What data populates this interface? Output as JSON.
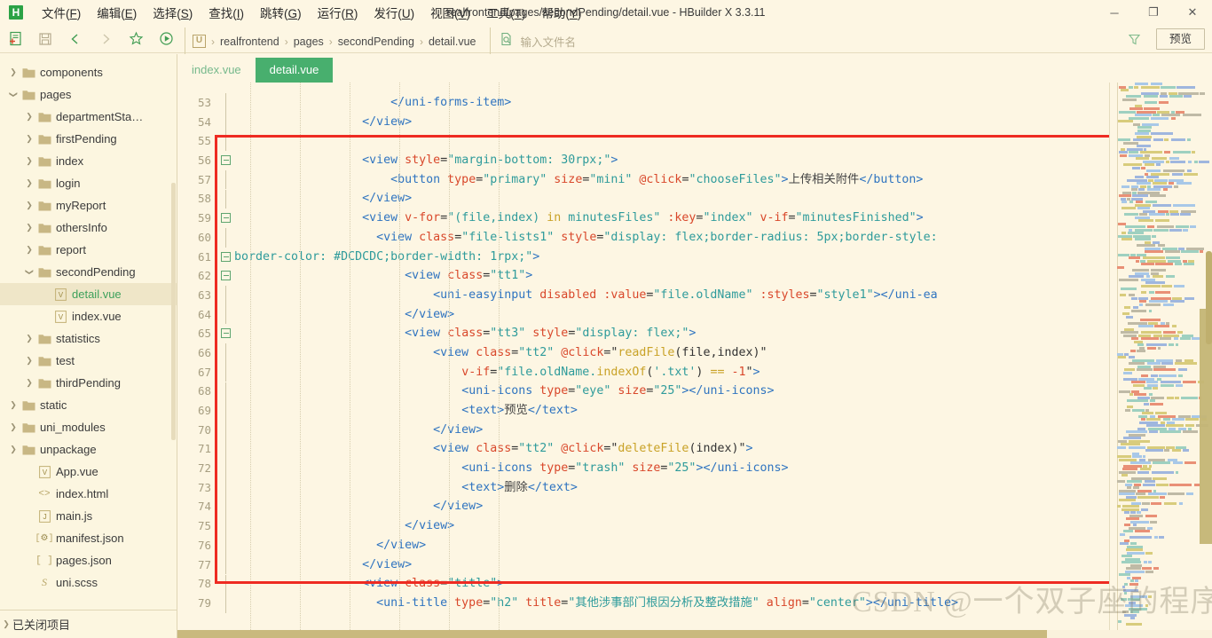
{
  "window": {
    "title": "realfrontend/pages/secondPending/detail.vue - HBuilder X 3.3.11",
    "logo_text": "H",
    "minimize_label": "─",
    "maximize_label": "❐",
    "close_label": "✕"
  },
  "menubar": {
    "items": [
      {
        "label": "文件(F)",
        "name": "menu-file"
      },
      {
        "label": "编辑(E)",
        "name": "menu-edit"
      },
      {
        "label": "选择(S)",
        "name": "menu-select"
      },
      {
        "label": "查找(I)",
        "name": "menu-find"
      },
      {
        "label": "跳转(G)",
        "name": "menu-goto"
      },
      {
        "label": "运行(R)",
        "name": "menu-run"
      },
      {
        "label": "发行(U)",
        "name": "menu-publish"
      },
      {
        "label": "视图(V)",
        "name": "menu-view"
      },
      {
        "label": "工具(T)",
        "name": "menu-tools"
      },
      {
        "label": "帮助(Y)",
        "name": "menu-help"
      }
    ]
  },
  "toolbar": {
    "icons": [
      {
        "name": "new-file-icon",
        "glyph": "new"
      },
      {
        "name": "save-icon",
        "glyph": "save"
      },
      {
        "name": "back-icon",
        "glyph": "‹"
      },
      {
        "name": "forward-icon",
        "glyph": "›"
      },
      {
        "name": "bookmark-icon",
        "glyph": "☆"
      },
      {
        "name": "run-icon",
        "glyph": "▶"
      }
    ],
    "breadcrumb": {
      "badge": "U",
      "items": [
        "realfrontend",
        "pages",
        "secondPending",
        "detail.vue"
      ],
      "separator": "›"
    },
    "search": {
      "placeholder": "输入文件名",
      "icon": "search-file-icon"
    },
    "filter_icon": "filter-icon",
    "preview_label": "预览"
  },
  "sidebar": {
    "closed_projects_label": "已关闭项目",
    "tree": [
      {
        "label": "components",
        "depth": 1,
        "kind": "folder",
        "state": "collapsed"
      },
      {
        "label": "pages",
        "depth": 1,
        "kind": "folder",
        "state": "expanded"
      },
      {
        "label": "departmentSta…",
        "depth": 2,
        "kind": "folder",
        "state": "collapsed"
      },
      {
        "label": "firstPending",
        "depth": 2,
        "kind": "folder",
        "state": "collapsed"
      },
      {
        "label": "index",
        "depth": 2,
        "kind": "folder",
        "state": "collapsed"
      },
      {
        "label": "login",
        "depth": 2,
        "kind": "folder",
        "state": "collapsed"
      },
      {
        "label": "myReport",
        "depth": 2,
        "kind": "folder",
        "state": "collapsed"
      },
      {
        "label": "othersInfo",
        "depth": 2,
        "kind": "folder",
        "state": "collapsed"
      },
      {
        "label": "report",
        "depth": 2,
        "kind": "folder",
        "state": "collapsed"
      },
      {
        "label": "secondPending",
        "depth": 2,
        "kind": "folder",
        "state": "expanded"
      },
      {
        "label": "detail.vue",
        "depth": 3,
        "kind": "vue",
        "state": "file",
        "selected": true
      },
      {
        "label": "index.vue",
        "depth": 3,
        "kind": "vue",
        "state": "file"
      },
      {
        "label": "statistics",
        "depth": 2,
        "kind": "folder",
        "state": "collapsed"
      },
      {
        "label": "test",
        "depth": 2,
        "kind": "folder",
        "state": "collapsed"
      },
      {
        "label": "thirdPending",
        "depth": 2,
        "kind": "folder",
        "state": "collapsed"
      },
      {
        "label": "static",
        "depth": 1,
        "kind": "folder",
        "state": "collapsed"
      },
      {
        "label": "uni_modules",
        "depth": 1,
        "kind": "folder",
        "state": "collapsed"
      },
      {
        "label": "unpackage",
        "depth": 1,
        "kind": "folder",
        "state": "collapsed"
      },
      {
        "label": "App.vue",
        "depth": 2,
        "kind": "vue",
        "state": "file"
      },
      {
        "label": "index.html",
        "depth": 2,
        "kind": "html",
        "state": "file"
      },
      {
        "label": "main.js",
        "depth": 2,
        "kind": "js",
        "state": "file"
      },
      {
        "label": "manifest.json",
        "depth": 2,
        "kind": "manifest",
        "state": "file"
      },
      {
        "label": "pages.json",
        "depth": 2,
        "kind": "json",
        "state": "file"
      },
      {
        "label": "uni.scss",
        "depth": 2,
        "kind": "scss",
        "state": "file"
      }
    ]
  },
  "tabs": [
    {
      "label": "index.vue",
      "active": false,
      "name": "tab-index-vue"
    },
    {
      "label": "detail.vue",
      "active": true,
      "name": "tab-detail-vue"
    }
  ],
  "editor": {
    "first_line": 53,
    "last_line": 79,
    "line_numbers": [
      53,
      54,
      55,
      56,
      57,
      58,
      59,
      60,
      61,
      62,
      63,
      64,
      65,
      66,
      67,
      68,
      69,
      70,
      71,
      72,
      73,
      74,
      75,
      76,
      77,
      78,
      79
    ],
    "lines": [
      {
        "n": 53,
        "indent": 22,
        "tokens": [
          {
            "t": "tag",
            "s": "</uni-forms-item>"
          }
        ]
      },
      {
        "n": 54,
        "indent": 18,
        "tokens": [
          {
            "t": "tag",
            "s": "</view>"
          }
        ]
      },
      {
        "n": 55,
        "indent": 0,
        "tokens": []
      },
      {
        "n": 56,
        "indent": 18,
        "fold": true,
        "tokens": [
          {
            "t": "tag",
            "s": "<view "
          },
          {
            "t": "attr",
            "s": "style"
          },
          {
            "t": "punc",
            "s": "="
          },
          {
            "t": "val",
            "s": "\"margin-bottom: 30rpx;\""
          },
          {
            "t": "tag",
            "s": ">"
          }
        ]
      },
      {
        "n": 57,
        "indent": 22,
        "tokens": [
          {
            "t": "tag",
            "s": "<button "
          },
          {
            "t": "attr",
            "s": "type"
          },
          {
            "t": "punc",
            "s": "="
          },
          {
            "t": "val",
            "s": "\"primary\""
          },
          {
            "t": "punc",
            "s": " "
          },
          {
            "t": "attr",
            "s": "size"
          },
          {
            "t": "punc",
            "s": "="
          },
          {
            "t": "val",
            "s": "\"mini\""
          },
          {
            "t": "punc",
            "s": " "
          },
          {
            "t": "attr",
            "s": "@click"
          },
          {
            "t": "punc",
            "s": "="
          },
          {
            "t": "val",
            "s": "\"chooseFiles\""
          },
          {
            "t": "tag",
            "s": ">"
          },
          {
            "t": "txt",
            "s": "上传相关附件"
          },
          {
            "t": "tag",
            "s": "</button>"
          }
        ]
      },
      {
        "n": 58,
        "indent": 18,
        "tokens": [
          {
            "t": "tag",
            "s": "</view>"
          }
        ]
      },
      {
        "n": 59,
        "indent": 18,
        "fold": true,
        "tokens": [
          {
            "t": "tag",
            "s": "<view "
          },
          {
            "t": "attr",
            "s": "v-for"
          },
          {
            "t": "punc",
            "s": "="
          },
          {
            "t": "val",
            "s": "\"(file,index) "
          },
          {
            "t": "kw",
            "s": "in"
          },
          {
            "t": "val",
            "s": " minutesFiles\""
          },
          {
            "t": "punc",
            "s": " "
          },
          {
            "t": "attr",
            "s": ":key"
          },
          {
            "t": "punc",
            "s": "="
          },
          {
            "t": "val",
            "s": "\"index\""
          },
          {
            "t": "punc",
            "s": " "
          },
          {
            "t": "attr",
            "s": "v-if"
          },
          {
            "t": "punc",
            "s": "="
          },
          {
            "t": "val",
            "s": "\"minutesFinished\""
          },
          {
            "t": "tag",
            "s": ">"
          }
        ]
      },
      {
        "n": 60,
        "indent": 20,
        "tokens": [
          {
            "t": "tag",
            "s": "<view "
          },
          {
            "t": "attr",
            "s": "class"
          },
          {
            "t": "punc",
            "s": "="
          },
          {
            "t": "val",
            "s": "\"file-lists1\""
          },
          {
            "t": "punc",
            "s": " "
          },
          {
            "t": "attr",
            "s": "style"
          },
          {
            "t": "punc",
            "s": "="
          },
          {
            "t": "val",
            "s": "\"display: flex;border-radius: 5px;border-style:"
          }
        ]
      },
      {
        "n": 61,
        "indent": 0,
        "fold": true,
        "tokens": [
          {
            "t": "val",
            "s": "border-color: #DCDCDC;border-width: 1rpx;\""
          },
          {
            "t": "tag",
            "s": ">"
          }
        ]
      },
      {
        "n": 62,
        "indent": 24,
        "fold": true,
        "tokens": [
          {
            "t": "tag",
            "s": "<view "
          },
          {
            "t": "attr",
            "s": "class"
          },
          {
            "t": "punc",
            "s": "="
          },
          {
            "t": "val",
            "s": "\"tt1\""
          },
          {
            "t": "tag",
            "s": ">"
          }
        ]
      },
      {
        "n": 63,
        "indent": 28,
        "tokens": [
          {
            "t": "tag",
            "s": "<uni-easyinput "
          },
          {
            "t": "attr",
            "s": "disabled"
          },
          {
            "t": "punc",
            "s": " "
          },
          {
            "t": "attr",
            "s": ":value"
          },
          {
            "t": "punc",
            "s": "="
          },
          {
            "t": "val",
            "s": "\"file.oldName\""
          },
          {
            "t": "punc",
            "s": " "
          },
          {
            "t": "attr",
            "s": ":styles"
          },
          {
            "t": "punc",
            "s": "="
          },
          {
            "t": "val",
            "s": "\"style1\""
          },
          {
            "t": "tag",
            "s": "></uni-ea"
          }
        ]
      },
      {
        "n": 64,
        "indent": 24,
        "tokens": [
          {
            "t": "tag",
            "s": "</view>"
          }
        ]
      },
      {
        "n": 65,
        "indent": 24,
        "fold": true,
        "tokens": [
          {
            "t": "tag",
            "s": "<view "
          },
          {
            "t": "attr",
            "s": "class"
          },
          {
            "t": "punc",
            "s": "="
          },
          {
            "t": "val",
            "s": "\"tt3\""
          },
          {
            "t": "punc",
            "s": " "
          },
          {
            "t": "attr",
            "s": "style"
          },
          {
            "t": "punc",
            "s": "="
          },
          {
            "t": "val",
            "s": "\"display: flex;\""
          },
          {
            "t": "tag",
            "s": ">"
          }
        ]
      },
      {
        "n": 66,
        "indent": 28,
        "tokens": [
          {
            "t": "tag",
            "s": "<view "
          },
          {
            "t": "attr",
            "s": "class"
          },
          {
            "t": "punc",
            "s": "="
          },
          {
            "t": "val",
            "s": "\"tt2\""
          },
          {
            "t": "punc",
            "s": " "
          },
          {
            "t": "attr",
            "s": "@click"
          },
          {
            "t": "punc",
            "s": "="
          },
          {
            "t": "punc",
            "s": "\""
          },
          {
            "t": "fn",
            "s": "readFile"
          },
          {
            "t": "punc",
            "s": "(file,index)\""
          }
        ]
      },
      {
        "n": 67,
        "indent": 32,
        "tokens": [
          {
            "t": "attr",
            "s": "v-if"
          },
          {
            "t": "punc",
            "s": "="
          },
          {
            "t": "val",
            "s": "\"file.oldName."
          },
          {
            "t": "fn",
            "s": "indexOf"
          },
          {
            "t": "punc",
            "s": "("
          },
          {
            "t": "val",
            "s": "'.txt'"
          },
          {
            "t": "punc",
            "s": ") "
          },
          {
            "t": "fn",
            "s": "=="
          },
          {
            "t": "punc",
            "s": " "
          },
          {
            "t": "attr",
            "s": "-1"
          },
          {
            "t": "punc",
            "s": "\""
          },
          {
            "t": "tag",
            "s": ">"
          }
        ]
      },
      {
        "n": 68,
        "indent": 32,
        "tokens": [
          {
            "t": "tag",
            "s": "<uni-icons "
          },
          {
            "t": "attr",
            "s": "type"
          },
          {
            "t": "punc",
            "s": "="
          },
          {
            "t": "val",
            "s": "\"eye\""
          },
          {
            "t": "punc",
            "s": " "
          },
          {
            "t": "attr",
            "s": "size"
          },
          {
            "t": "punc",
            "s": "="
          },
          {
            "t": "val",
            "s": "\"25\""
          },
          {
            "t": "tag",
            "s": "></uni-icons>"
          }
        ]
      },
      {
        "n": 69,
        "indent": 32,
        "tokens": [
          {
            "t": "tag",
            "s": "<text>"
          },
          {
            "t": "txt",
            "s": "预览"
          },
          {
            "t": "tag",
            "s": "</text>"
          }
        ]
      },
      {
        "n": 70,
        "indent": 28,
        "tokens": [
          {
            "t": "tag",
            "s": "</view>"
          }
        ]
      },
      {
        "n": 71,
        "indent": 28,
        "tokens": [
          {
            "t": "tag",
            "s": "<view "
          },
          {
            "t": "attr",
            "s": "class"
          },
          {
            "t": "punc",
            "s": "="
          },
          {
            "t": "val",
            "s": "\"tt2\""
          },
          {
            "t": "punc",
            "s": " "
          },
          {
            "t": "attr",
            "s": "@click"
          },
          {
            "t": "punc",
            "s": "="
          },
          {
            "t": "punc",
            "s": "\""
          },
          {
            "t": "fn",
            "s": "deleteFile"
          },
          {
            "t": "punc",
            "s": "(index)\""
          },
          {
            "t": "tag",
            "s": ">"
          }
        ]
      },
      {
        "n": 72,
        "indent": 32,
        "tokens": [
          {
            "t": "tag",
            "s": "<uni-icons "
          },
          {
            "t": "attr",
            "s": "type"
          },
          {
            "t": "punc",
            "s": "="
          },
          {
            "t": "val",
            "s": "\"trash\""
          },
          {
            "t": "punc",
            "s": " "
          },
          {
            "t": "attr",
            "s": "size"
          },
          {
            "t": "punc",
            "s": "="
          },
          {
            "t": "val",
            "s": "\"25\""
          },
          {
            "t": "tag",
            "s": "></uni-icons>"
          }
        ]
      },
      {
        "n": 73,
        "indent": 32,
        "tokens": [
          {
            "t": "tag",
            "s": "<text>"
          },
          {
            "t": "txt",
            "s": "删除"
          },
          {
            "t": "tag",
            "s": "</text>"
          }
        ]
      },
      {
        "n": 74,
        "indent": 28,
        "tokens": [
          {
            "t": "tag",
            "s": "</view>"
          }
        ]
      },
      {
        "n": 75,
        "indent": 24,
        "tokens": [
          {
            "t": "tag",
            "s": "</view>"
          }
        ]
      },
      {
        "n": 76,
        "indent": 20,
        "tokens": [
          {
            "t": "tag",
            "s": "</view>"
          }
        ]
      },
      {
        "n": 77,
        "indent": 18,
        "tokens": [
          {
            "t": "tag",
            "s": "</view>"
          }
        ]
      },
      {
        "n": 78,
        "indent": 18,
        "tokens": [
          {
            "t": "tag",
            "s": "<view "
          },
          {
            "t": "attr",
            "s": "class"
          },
          {
            "t": "punc",
            "s": "="
          },
          {
            "t": "val",
            "s": "\"title\""
          },
          {
            "t": "tag",
            "s": ">"
          }
        ]
      },
      {
        "n": 79,
        "indent": 20,
        "tokens": [
          {
            "t": "tag",
            "s": "<uni-title "
          },
          {
            "t": "attr",
            "s": "type"
          },
          {
            "t": "punc",
            "s": "="
          },
          {
            "t": "val",
            "s": "\"h2\""
          },
          {
            "t": "punc",
            "s": " "
          },
          {
            "t": "attr",
            "s": "title"
          },
          {
            "t": "punc",
            "s": "="
          },
          {
            "t": "val",
            "s": "\"其他涉事部门根因分析及整改措施\""
          },
          {
            "t": "punc",
            "s": " "
          },
          {
            "t": "attr",
            "s": "align"
          },
          {
            "t": "punc",
            "s": "="
          },
          {
            "t": "val",
            "s": "\"center\""
          },
          {
            "t": "tag",
            "s": "></uni-title>"
          }
        ]
      }
    ],
    "annotation": {
      "name": "red-highlight-box",
      "color": "#EE2B22"
    }
  },
  "watermark": {
    "text": "CSDN @一个双子座的程序猿"
  },
  "colors": {
    "background": "#FDF6E3",
    "accent_green": "#48AF6E",
    "tag": "#2F74C0",
    "attribute": "#D9482B",
    "value": "#2E9B9B",
    "function": "#C9A227",
    "annotation": "#EE2B22",
    "selection": "#EFE6C8"
  }
}
